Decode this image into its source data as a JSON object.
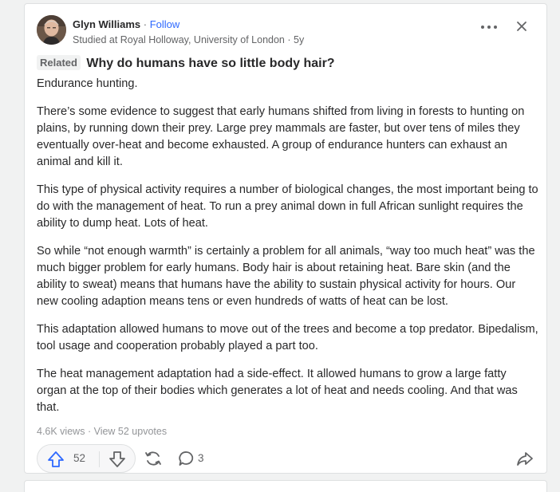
{
  "colors": {
    "page_background": "#f1f2f2",
    "card_background": "#ffffff",
    "text": "#282829",
    "secondary_text": "#636466",
    "muted_text": "#939598",
    "follow_link": "#2e69ff",
    "upvote_icon": "#2e69ff"
  },
  "author": {
    "name": "Glyn Williams",
    "separator": "·",
    "follow_label": "Follow",
    "credential": "Studied at Royal Holloway, University of London",
    "age": "5y"
  },
  "header_icons": {
    "more": "more-options-icon",
    "close": "close-icon"
  },
  "question": {
    "tag": "Related",
    "text": "Why do humans have so little body hair?"
  },
  "answer": {
    "paragraphs": [
      "Endurance hunting.",
      "There’s some evidence to suggest that early humans shifted from living in forests to hunting on plains, by running down their prey. Large prey mammals are faster, but over tens of miles they eventually over-heat and become exhausted. A group of endurance hunters can exhaust an animal and kill it.",
      "This type of physical activity requires a number of biological changes, the most important being to do with the management of heat. To run a prey animal down in full African sunlight requires the ability to dump heat. Lots of heat.",
      "So while “not enough warmth” is certainly a problem for all animals, “way too much heat” was the much bigger problem for early humans. Body hair is about retaining heat. Bare skin (and the ability to sweat) means that humans have the ability to sustain physical activity for hours. Our new cooling adaption means tens or even hundreds of watts of heat can be lost.",
      "This adaptation allowed humans to move out of the trees and become a top predator. Bipedalism, tool usage and cooperation probably played a part too.",
      "The heat management adaptation had a side-effect. It allowed humans to grow a large fatty organ at the top of their bodies which generates a lot of heat and needs cooling. And that was that."
    ]
  },
  "stats": {
    "views": "4.6K views",
    "separator": "·",
    "upvotes_link": "View 52 upvotes"
  },
  "actions": {
    "upvote_count": "52",
    "comment_count": "3",
    "icons": [
      "upvote-arrow-icon",
      "downvote-arrow-icon",
      "share-icon",
      "comment-icon",
      "forward-icon"
    ]
  }
}
